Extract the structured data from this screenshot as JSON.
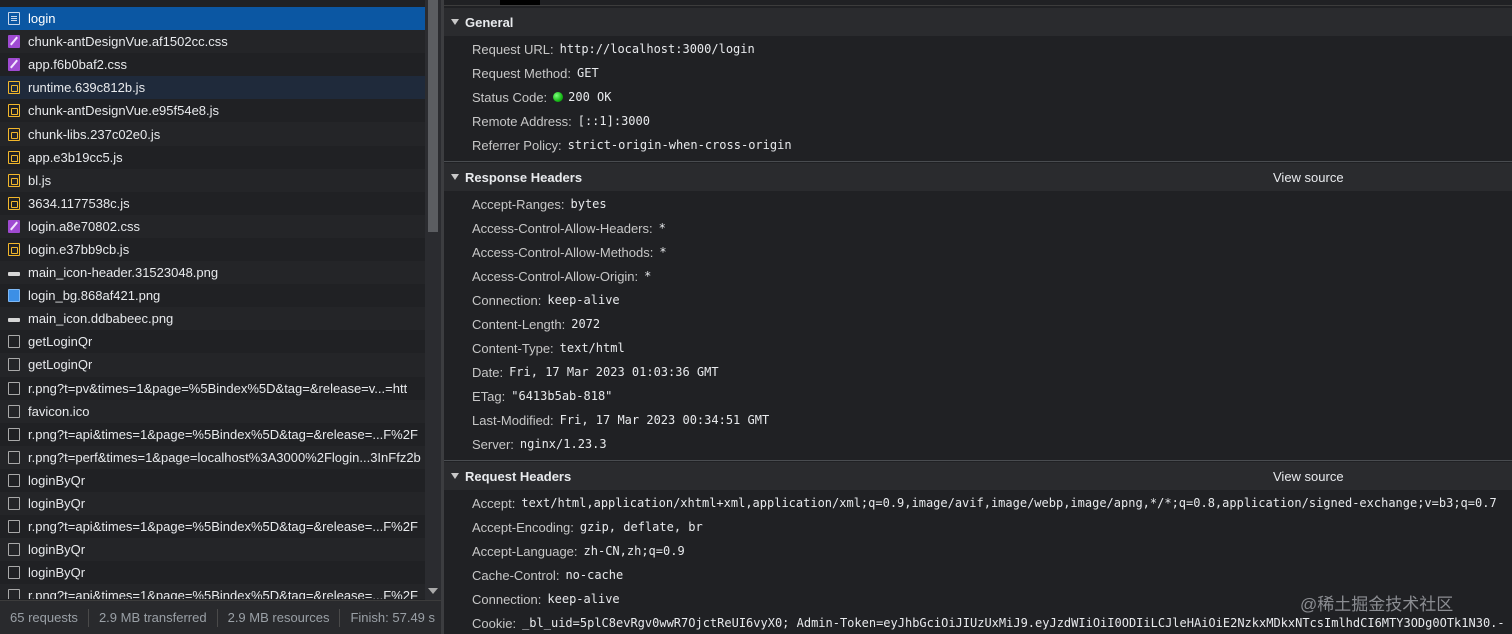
{
  "requests": [
    {
      "name": "login",
      "icon": "doc"
    },
    {
      "name": "chunk-antDesignVue.af1502cc.css",
      "icon": "css"
    },
    {
      "name": "app.f6b0baf2.css",
      "icon": "css"
    },
    {
      "name": "runtime.639c812b.js",
      "icon": "js"
    },
    {
      "name": "chunk-antDesignVue.e95f54e8.js",
      "icon": "js"
    },
    {
      "name": "chunk-libs.237c02e0.js",
      "icon": "js"
    },
    {
      "name": "app.e3b19cc5.js",
      "icon": "js"
    },
    {
      "name": "bl.js",
      "icon": "js"
    },
    {
      "name": "3634.1177538c.js",
      "icon": "js"
    },
    {
      "name": "login.a8e70802.css",
      "icon": "css"
    },
    {
      "name": "login.e37bb9cb.js",
      "icon": "js"
    },
    {
      "name": "main_icon-header.31523048.png",
      "icon": "imgw"
    },
    {
      "name": "login_bg.868af421.png",
      "icon": "imgb"
    },
    {
      "name": "main_icon.ddbabeec.png",
      "icon": "imgw"
    },
    {
      "name": "getLoginQr",
      "icon": "plain"
    },
    {
      "name": "getLoginQr",
      "icon": "plain"
    },
    {
      "name": "r.png?t=pv&times=1&page=%5Bindex%5D&tag=&release=v...=htt",
      "icon": "plain"
    },
    {
      "name": "favicon.ico",
      "icon": "plain"
    },
    {
      "name": "r.png?t=api&times=1&page=%5Bindex%5D&tag=&release=...F%2F",
      "icon": "plain"
    },
    {
      "name": "r.png?t=perf&times=1&page=localhost%3A3000%2Flogin...3InFfz2b",
      "icon": "plain"
    },
    {
      "name": "loginByQr",
      "icon": "plain"
    },
    {
      "name": "loginByQr",
      "icon": "plain"
    },
    {
      "name": "r.png?t=api&times=1&page=%5Bindex%5D&tag=&release=...F%2F",
      "icon": "plain"
    },
    {
      "name": "loginByQr",
      "icon": "plain"
    },
    {
      "name": "loginByQr",
      "icon": "plain"
    },
    {
      "name": "r.png?t=api&times=1&page=%5Bindex%5D&tag=&release=...F%2F",
      "icon": "plain"
    }
  ],
  "status": {
    "requests": "65 requests",
    "transferred": "2.9 MB transferred",
    "resources": "2.9 MB resources",
    "finish": "Finish: 57.49 s"
  },
  "general": {
    "title": "General",
    "rows": [
      {
        "k": "Request URL:",
        "v": "http://localhost:3000/login"
      },
      {
        "k": "Request Method:",
        "v": "GET"
      },
      {
        "k": "Status Code:",
        "v": "200 OK",
        "dot": true
      },
      {
        "k": "Remote Address:",
        "v": "[::1]:3000"
      },
      {
        "k": "Referrer Policy:",
        "v": "strict-origin-when-cross-origin"
      }
    ]
  },
  "response_headers": {
    "title": "Response Headers",
    "view_source": "View source",
    "rows": [
      {
        "k": "Accept-Ranges:",
        "v": "bytes"
      },
      {
        "k": "Access-Control-Allow-Headers:",
        "v": "*"
      },
      {
        "k": "Access-Control-Allow-Methods:",
        "v": "*"
      },
      {
        "k": "Access-Control-Allow-Origin:",
        "v": "*"
      },
      {
        "k": "Connection:",
        "v": "keep-alive"
      },
      {
        "k": "Content-Length:",
        "v": "2072"
      },
      {
        "k": "Content-Type:",
        "v": "text/html"
      },
      {
        "k": "Date:",
        "v": "Fri, 17 Mar 2023 01:03:36 GMT"
      },
      {
        "k": "ETag:",
        "v": "\"6413b5ab-818\""
      },
      {
        "k": "Last-Modified:",
        "v": "Fri, 17 Mar 2023 00:34:51 GMT"
      },
      {
        "k": "Server:",
        "v": "nginx/1.23.3"
      }
    ]
  },
  "request_headers": {
    "title": "Request Headers",
    "view_source": "View source",
    "rows": [
      {
        "k": "Accept:",
        "v": "text/html,application/xhtml+xml,application/xml;q=0.9,image/avif,image/webp,image/apng,*/*;q=0.8,application/signed-exchange;v=b3;q=0.7"
      },
      {
        "k": "Accept-Encoding:",
        "v": "gzip, deflate, br"
      },
      {
        "k": "Accept-Language:",
        "v": "zh-CN,zh;q=0.9"
      },
      {
        "k": "Cache-Control:",
        "v": "no-cache"
      },
      {
        "k": "Connection:",
        "v": "keep-alive"
      },
      {
        "k": "Cookie:",
        "v": "_bl_uid=5plC8evRgv0wwR7OjctReUI6vyX0; Admin-Token=eyJhbGciOiJIUzUxMiJ9.eyJzdWIiOiI0ODIiLCJleHAiOiE2NzkxMDkxNTcsImlhdCI6MTY3ODg0OTk1N30.-"
      }
    ]
  },
  "watermark": "@稀土掘金技术社区",
  "colors": {
    "selected_row": "#0b57a3",
    "status_dot": "#16b916",
    "background": "#202124"
  }
}
